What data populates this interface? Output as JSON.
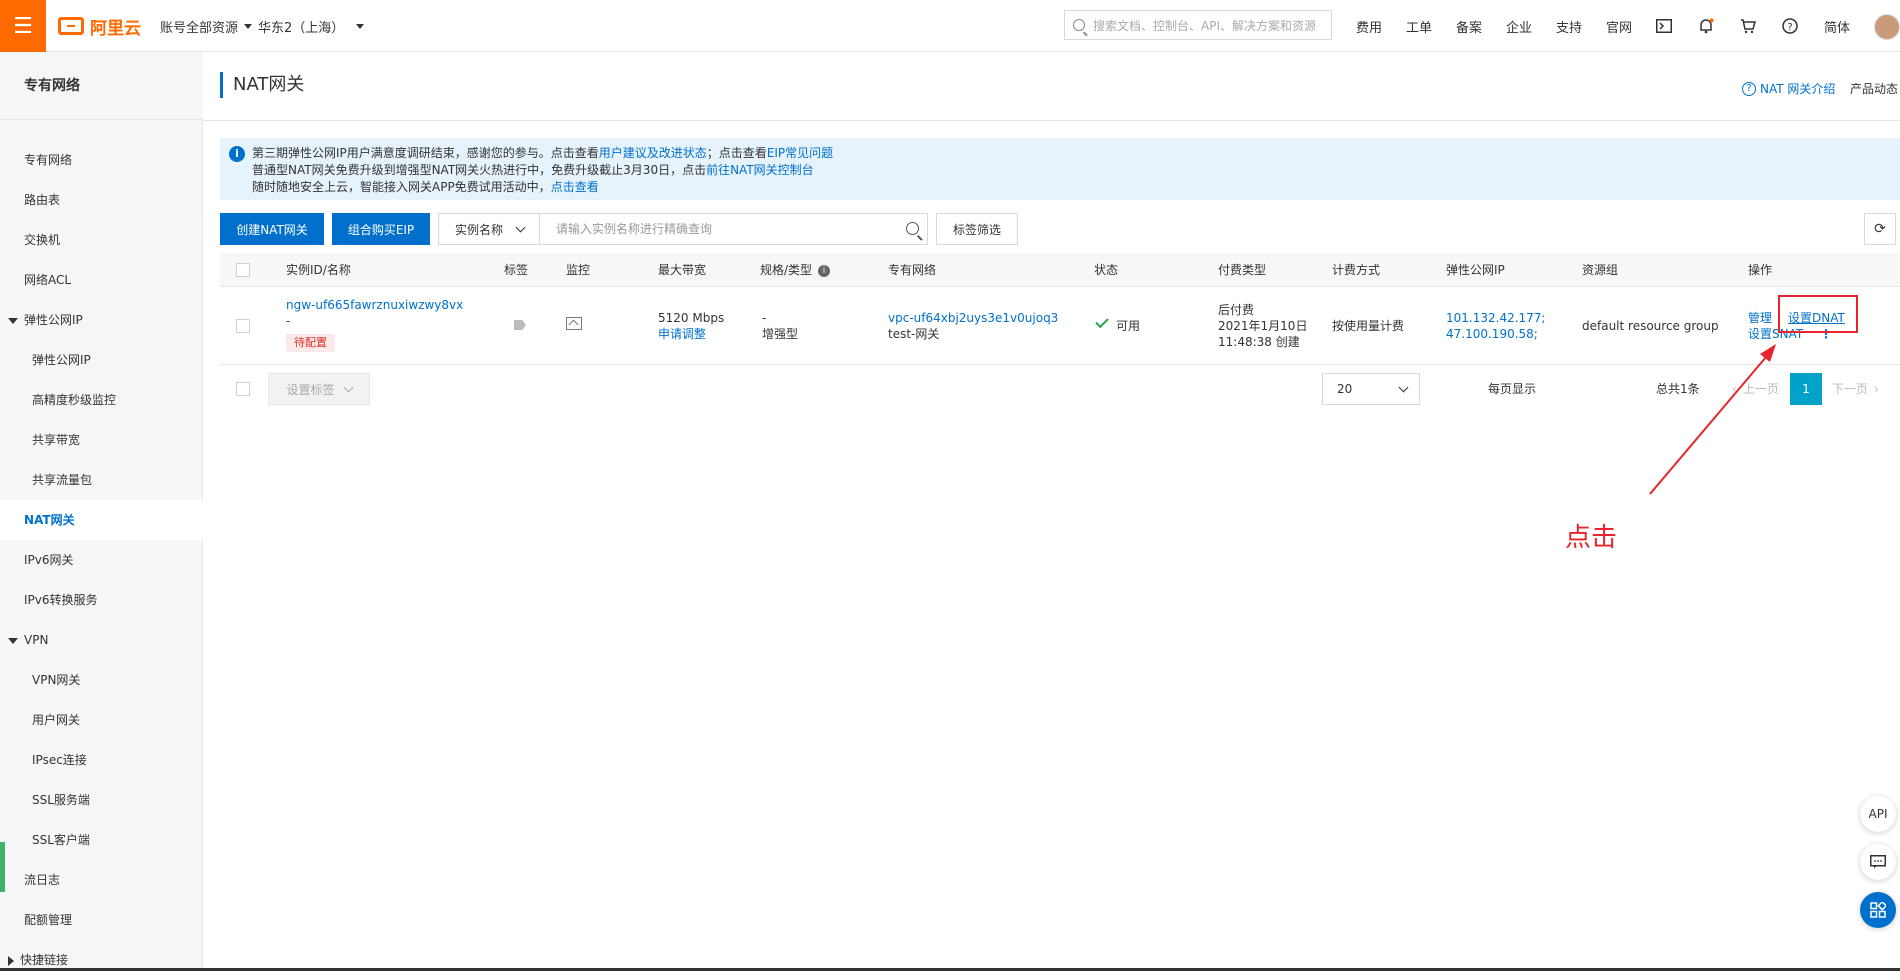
{
  "topbar": {
    "menu_icon": "hamburger-icon",
    "logo_text": "阿里云",
    "account_scope": "账号全部资源",
    "region": "华东2（上海）",
    "search_placeholder": "搜索文档、控制台、API、解决方案和资源",
    "nav": [
      "费用",
      "工单",
      "备案",
      "企业",
      "支持",
      "官网"
    ],
    "icons": [
      "terminal-icon",
      "bell-icon",
      "cart-icon",
      "help-icon"
    ],
    "lang": "简体"
  },
  "sidebar": {
    "title": "专有网络",
    "items": [
      {
        "label": "专有网络",
        "level": 0
      },
      {
        "label": "路由表",
        "level": 0
      },
      {
        "label": "交换机",
        "level": 0
      },
      {
        "label": "网络ACL",
        "level": 0
      },
      {
        "label": "弹性公网IP",
        "level": 0,
        "group": "expanded"
      },
      {
        "label": "弹性公网IP",
        "level": 1
      },
      {
        "label": "高精度秒级监控",
        "level": 1
      },
      {
        "label": "共享带宽",
        "level": 1
      },
      {
        "label": "共享流量包",
        "level": 1
      },
      {
        "label": "NAT网关",
        "level": 0,
        "active": true
      },
      {
        "label": "IPv6网关",
        "level": 0
      },
      {
        "label": "IPv6转换服务",
        "level": 0
      },
      {
        "label": "VPN",
        "level": 0,
        "group": "expanded"
      },
      {
        "label": "VPN网关",
        "level": 1
      },
      {
        "label": "用户网关",
        "level": 1
      },
      {
        "label": "IPsec连接",
        "level": 1
      },
      {
        "label": "SSL服务端",
        "level": 1
      },
      {
        "label": "SSL客户端",
        "level": 1
      },
      {
        "label": "流日志",
        "level": 0
      },
      {
        "label": "配额管理",
        "level": 0
      },
      {
        "label": "快捷链接",
        "level": 0,
        "group": "collapsed"
      }
    ]
  },
  "page": {
    "title": "NAT网关",
    "help_link": "NAT 网关介绍",
    "product_news": "产品动态"
  },
  "notice": {
    "line1_prefix": "第三期弹性公网IP用户满意度调研结束，感谢您的参与。点击查看",
    "line1_link1": "用户建议及改进状态",
    "line1_mid": "；点击查看",
    "line1_link2": "EIP常见问题",
    "line2_prefix": "普通型NAT网关免费升级到增强型NAT网关火热进行中，免费升级截止3月30日，点击",
    "line2_link": "前往NAT网关控制台",
    "line3_prefix": "随时随地安全上云，智能接入网关APP免费试用活动中，",
    "line3_link": "点击查看"
  },
  "toolbar": {
    "create_btn": "创建NAT网关",
    "buy_eip_btn": "组合购买EIP",
    "filter_select": "实例名称",
    "search_placeholder": "请输入实例名称进行精确查询",
    "tag_filter_btn": "标签筛选"
  },
  "table": {
    "headers": [
      "实例ID/名称",
      "标签",
      "监控",
      "最大带宽",
      "规格/类型",
      "专有网络",
      "状态",
      "付费类型",
      "计费方式",
      "弹性公网IP",
      "资源组",
      "操作"
    ],
    "row": {
      "id": "ngw-uf665fawrznuxiwzwy8vx",
      "name": "-",
      "status_badge": "待配置",
      "bandwidth": "5120 Mbps",
      "bandwidth_link": "申请调整",
      "spec": "-",
      "type": "增强型",
      "vpc_id": "vpc-uf64xbj2uys3e1v0ujoq3",
      "vpc_name": "test-网关",
      "status": "可用",
      "pay_type": "后付费",
      "created_date": "2021年1月10日",
      "created_time": "11:48:38 创建",
      "billing": "按使用量计费",
      "eip1": "101.132.42.177;",
      "eip2": "47.100.190.58;",
      "resource_group": "default resource group",
      "op_manage": "管理",
      "op_dnat": "设置DNAT",
      "op_snat": "设置SNAT",
      "op_more": "⋮"
    }
  },
  "footer": {
    "set_tag_btn": "设置标签",
    "per_page_label": "每页显示",
    "per_page_value": "20",
    "total": "总共1条",
    "prev": "上一页",
    "current_page": "1",
    "next": "下一页"
  },
  "annotation": {
    "text": "点击",
    "color": "#e6262e"
  },
  "float_buttons": {
    "api": "API",
    "chat_icon": "chat-icon",
    "apps_icon": "apps-icon"
  },
  "colors": {
    "brand_orange": "#ff6a00",
    "link_blue": "#0070cc",
    "page_active": "#00a2ca"
  }
}
